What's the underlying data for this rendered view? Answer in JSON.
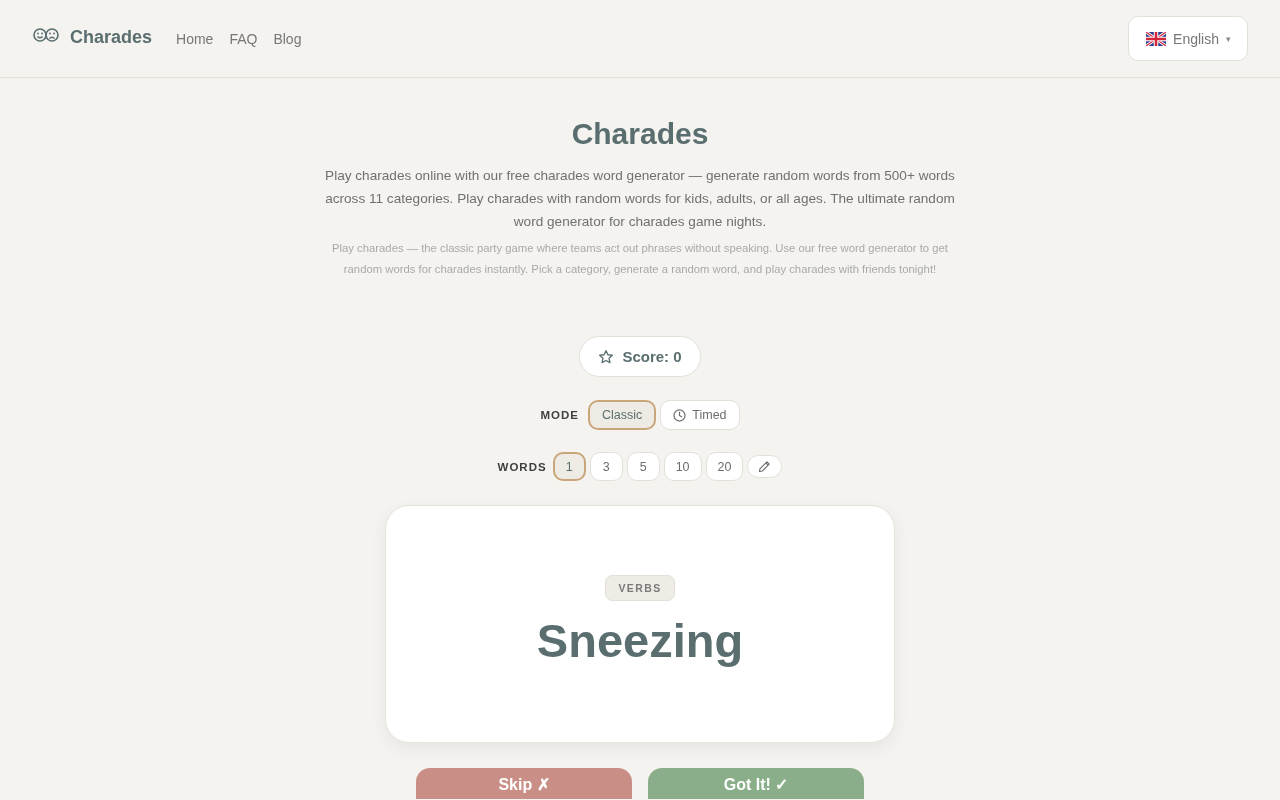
{
  "header": {
    "logo": {
      "text": "Charades"
    },
    "nav": [
      {
        "label": "Home"
      },
      {
        "label": "FAQ"
      },
      {
        "label": "Blog"
      }
    ],
    "language": {
      "label": "English",
      "caret": "▾"
    }
  },
  "hero": {
    "title": "Charades",
    "intro": "Play charades online with our free charades word generator — generate random words from 500+ words across 11 categories. Play charades with random words for kids, adults, or all ages. The ultimate random word generator for charades game nights.",
    "description": "Play charades — the classic party game where teams act out phrases without speaking. Use our free word generator to get random words for charades instantly. Pick a category, generate a random word, and play charades with friends tonight!"
  },
  "score": {
    "label": "Score: 0"
  },
  "mode": {
    "label": "MODE",
    "options": [
      {
        "kind": "classic",
        "label": "Classic",
        "selected": true
      },
      {
        "kind": "timed",
        "label": "Timed",
        "selected": false
      }
    ]
  },
  "words": {
    "label": "WORDS",
    "options": [
      {
        "kind": "number",
        "label": "1",
        "selected": true
      },
      {
        "kind": "number",
        "label": "3",
        "selected": false
      },
      {
        "kind": "number",
        "label": "5",
        "selected": false
      },
      {
        "kind": "number",
        "label": "10",
        "selected": false
      },
      {
        "kind": "number",
        "label": "20",
        "selected": false
      },
      {
        "kind": "custom",
        "selected": false
      }
    ]
  },
  "card": {
    "category": "VERBS",
    "word": "Sneezing"
  },
  "actions": [
    {
      "kind": "skip",
      "label": "Skip ✗"
    },
    {
      "kind": "got_it",
      "label": "Got It! ✓"
    }
  ]
}
